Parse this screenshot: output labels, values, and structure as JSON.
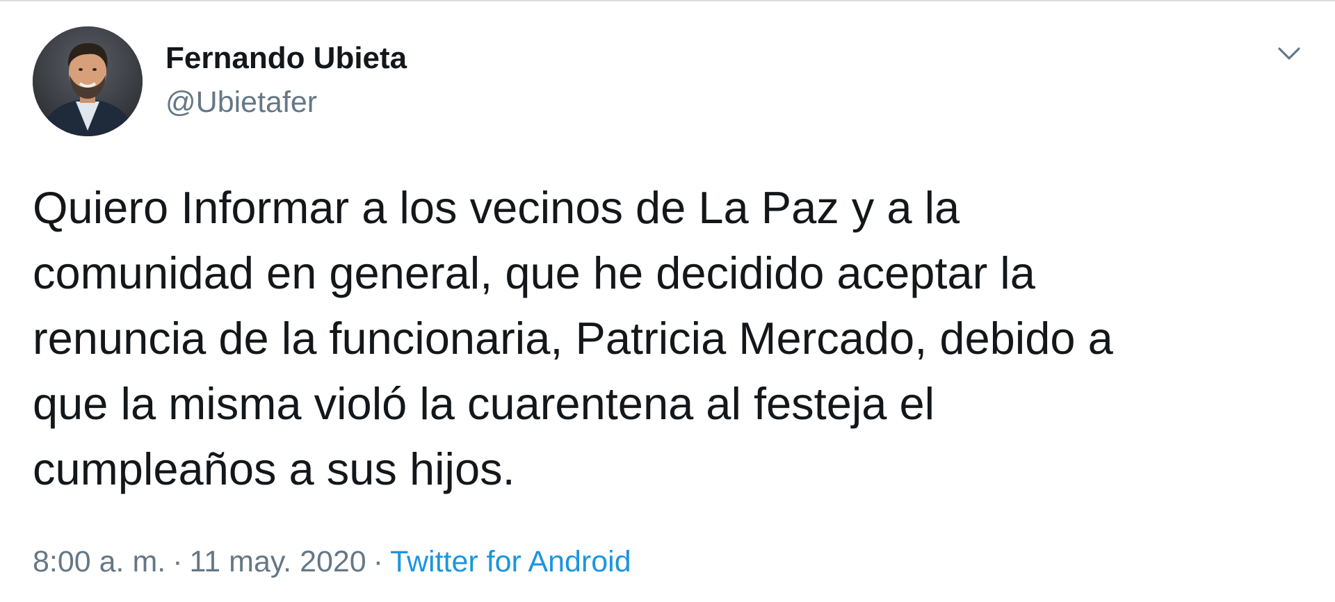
{
  "user": {
    "display_name": "Fernando Ubieta",
    "handle": "@Ubietafer"
  },
  "tweet": {
    "text_lines": [
      "Quiero Informar a los vecinos de La Paz y a la",
      "comunidad en general, que he decidido aceptar la",
      "renuncia de la funcionaria, Patricia Mercado, debido a",
      "que la misma violó la cuarentena al festeja el",
      "cumpleaños a sus hijos."
    ]
  },
  "meta": {
    "time": "8:00 a. m.",
    "separator": "·",
    "date": "11 may. 2020",
    "source": "Twitter for Android"
  },
  "icons": {
    "menu": "chevron-down-icon"
  },
  "colors": {
    "text": "#14171a",
    "secondary": "#657786",
    "link": "#1b95e0",
    "background": "#ffffff"
  }
}
